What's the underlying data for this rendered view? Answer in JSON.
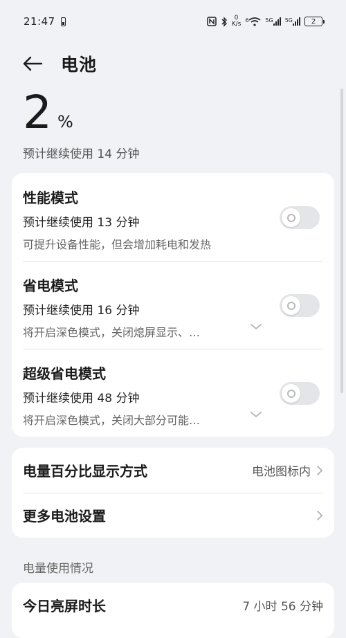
{
  "status_bar": {
    "time": "21:47",
    "net_speed_value": "0",
    "net_speed_unit": "K/s",
    "sim1_label": "5G",
    "sim2_label": "5G",
    "wifi_label": "6",
    "battery_level": "2"
  },
  "header": {
    "title": "电池"
  },
  "battery": {
    "level": "2",
    "unit": "%",
    "estimate": "预计继续使用 14 分钟"
  },
  "modes": [
    {
      "title": "性能模式",
      "estimate": "预计继续使用 13 分钟",
      "description": "可提升设备性能，但会增加耗电和发热",
      "enabled": false
    },
    {
      "title": "省电模式",
      "estimate": "预计继续使用 16 分钟",
      "description": "将开启深色模式，关闭熄屏显示、…",
      "enabled": false
    },
    {
      "title": "超级省电模式",
      "estimate": "预计继续使用 48 分钟",
      "description": "将开启深色模式，关闭大部分可能…",
      "enabled": false
    }
  ],
  "settings": [
    {
      "label": "电量百分比显示方式",
      "value": "电池图标内"
    },
    {
      "label": "更多电池设置",
      "value": ""
    }
  ],
  "usage": {
    "section_label": "电量使用情况",
    "screen_time_label": "今日亮屏时长",
    "screen_time_value": "7 小时 56 分钟"
  },
  "colors": {
    "background": "#f1f2f6",
    "card": "#ffffff",
    "toggle_off": "#e4e5e9"
  }
}
